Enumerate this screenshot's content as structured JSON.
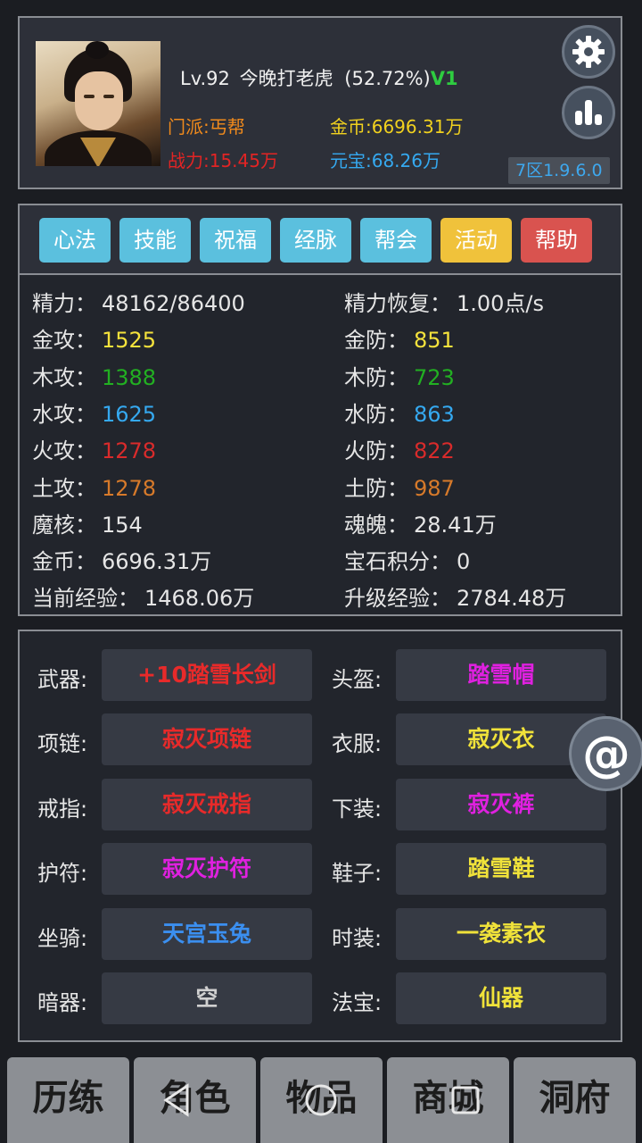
{
  "header": {
    "level": "Lv.92",
    "player_name": "今晚打老虎",
    "exp_percent": "(52.72%)",
    "vip": "V1",
    "sect": "门派:丐帮",
    "power": "战力:15.45万",
    "gold": "金币:6696.31万",
    "yuanbao": "元宝:68.26万",
    "server": "7区1.9.6.0"
  },
  "tabs": [
    {
      "label": "心法",
      "color": "#5bc0de"
    },
    {
      "label": "技能",
      "color": "#5bc0de"
    },
    {
      "label": "祝福",
      "color": "#5bc0de"
    },
    {
      "label": "经脉",
      "color": "#5bc0de"
    },
    {
      "label": "帮会",
      "color": "#5bc0de"
    },
    {
      "label": "活动",
      "color": "#f0c23b"
    },
    {
      "label": "帮助",
      "color": "#d9534f"
    }
  ],
  "stats": {
    "left": [
      {
        "label": "精力：",
        "value": "48162/86400",
        "color": "#e6e6e6"
      },
      {
        "label": "金攻：",
        "value": "1525",
        "color": "#f5e23c"
      },
      {
        "label": "木攻：",
        "value": "1388",
        "color": "#22b022"
      },
      {
        "label": "水攻：",
        "value": "1625",
        "color": "#35a9f0"
      },
      {
        "label": "火攻：",
        "value": "1278",
        "color": "#d92b2b"
      },
      {
        "label": "土攻：",
        "value": "1278",
        "color": "#d77a2a"
      },
      {
        "label": "魔核：",
        "value": "154",
        "color": "#e6e6e6"
      },
      {
        "label": "金币：",
        "value": "6696.31万",
        "color": "#e6e6e6"
      },
      {
        "label": "当前经验：",
        "value": "1468.06万",
        "color": "#e6e6e6"
      }
    ],
    "right": [
      {
        "label": "精力恢复：",
        "value": "1.00点/s",
        "color": "#e6e6e6"
      },
      {
        "label": "金防：",
        "value": "851",
        "color": "#f5e23c"
      },
      {
        "label": "木防：",
        "value": "723",
        "color": "#22b022"
      },
      {
        "label": "水防：",
        "value": "863",
        "color": "#35a9f0"
      },
      {
        "label": "火防：",
        "value": "822",
        "color": "#d92b2b"
      },
      {
        "label": "土防：",
        "value": "987",
        "color": "#d77a2a"
      },
      {
        "label": "魂魄：",
        "value": "28.41万",
        "color": "#e6e6e6"
      },
      {
        "label": "宝石积分：",
        "value": "0",
        "color": "#e6e6e6"
      },
      {
        "label": "升级经验：",
        "value": "2784.48万",
        "color": "#e6e6e6"
      }
    ]
  },
  "equipment": {
    "left": [
      {
        "slot": "武器:",
        "item": "+10踏雪长剑",
        "color": "#e82a2a"
      },
      {
        "slot": "项链:",
        "item": "寂灭项链",
        "color": "#e82a2a"
      },
      {
        "slot": "戒指:",
        "item": "寂灭戒指",
        "color": "#e82a2a"
      },
      {
        "slot": "护符:",
        "item": "寂灭护符",
        "color": "#e020e0"
      },
      {
        "slot": "坐骑:",
        "item": "天宫玉兔",
        "color": "#3b8ff0"
      },
      {
        "slot": "暗器:",
        "item": "空",
        "color": "#d0d0d0"
      }
    ],
    "right": [
      {
        "slot": "头盔:",
        "item": "踏雪帽",
        "color": "#e020e0"
      },
      {
        "slot": "衣服:",
        "item": "寂灭衣",
        "color": "#f0e23a"
      },
      {
        "slot": "下装:",
        "item": "寂灭裤",
        "color": "#e020e0"
      },
      {
        "slot": "鞋子:",
        "item": "踏雪鞋",
        "color": "#f0e23a"
      },
      {
        "slot": "时装:",
        "item": "一袭素衣",
        "color": "#f0e23a"
      },
      {
        "slot": "法宝:",
        "item": "仙器",
        "color": "#f0e23a"
      }
    ]
  },
  "bottom_nav": [
    "历练",
    "角色",
    "物品",
    "商城",
    "洞府"
  ],
  "icons": {
    "settings": "gear-icon",
    "ranking": "bar-chart-icon",
    "at": "at-icon",
    "back": "back-triangle-icon",
    "home": "home-circle-icon",
    "recents": "recents-square-icon"
  }
}
